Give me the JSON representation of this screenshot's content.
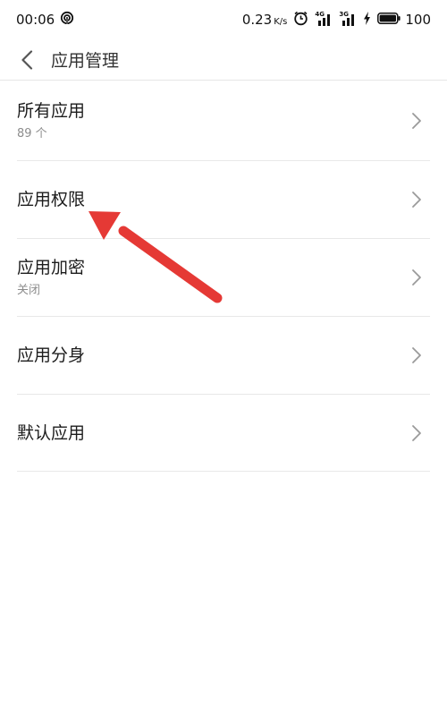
{
  "status_bar": {
    "time": "00:06",
    "net_speed": "0.23",
    "net_unit": "K/s",
    "sim1_label": "4G",
    "sim2_label": "3G",
    "battery": "100"
  },
  "header": {
    "title": "应用管理"
  },
  "items": [
    {
      "title": "所有应用",
      "subtitle": "89 个"
    },
    {
      "title": "应用权限"
    },
    {
      "title": "应用加密",
      "subtitle": "关闭"
    },
    {
      "title": "应用分身"
    },
    {
      "title": "默认应用"
    }
  ],
  "colors": {
    "annotation_arrow": "#e53935",
    "divider": "#e8e8e8",
    "chevron": "#9a9a9a"
  },
  "icons": {
    "hotspot": "hotspot-icon",
    "alarm": "alarm-icon",
    "signal": "signal-icon",
    "charging": "charging-icon",
    "battery": "battery-icon",
    "back": "back-arrow-icon",
    "chevron": "chevron-right-icon"
  }
}
